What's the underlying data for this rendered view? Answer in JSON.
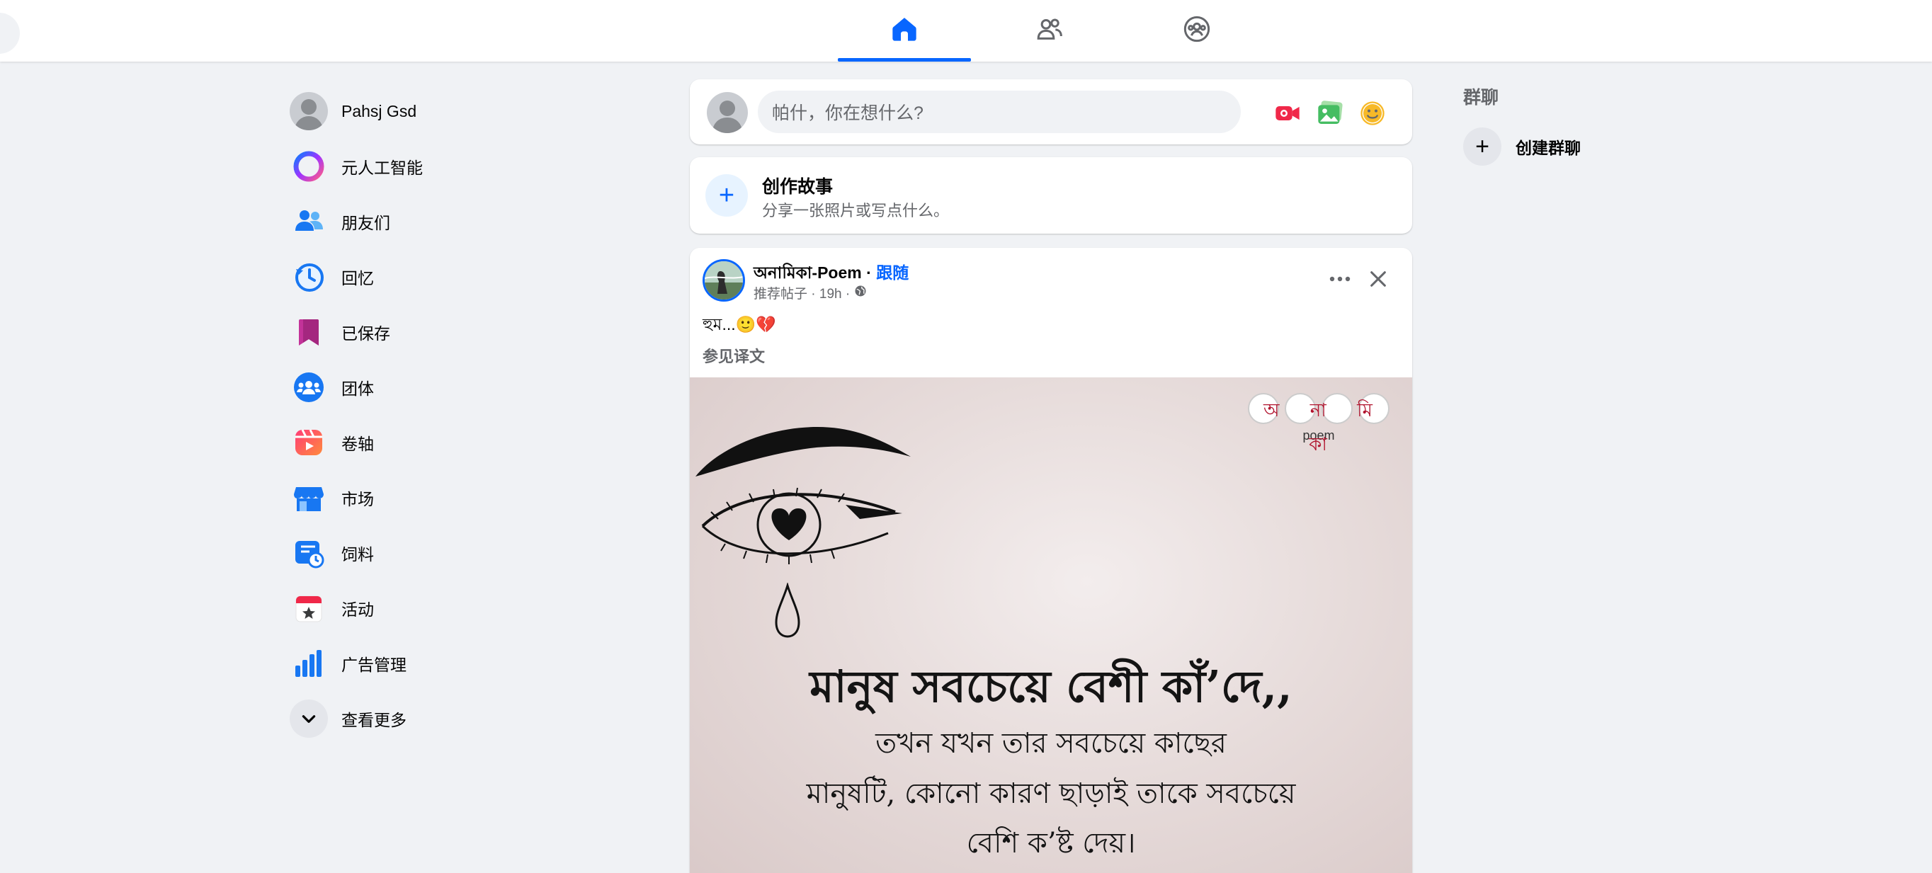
{
  "topbar": {
    "tabs": [
      {
        "name": "home",
        "icon": "home-icon",
        "active": true
      },
      {
        "name": "friends",
        "icon": "friends-icon",
        "active": false
      },
      {
        "name": "groups",
        "icon": "groups-icon",
        "active": false
      }
    ],
    "accent": "#0866ff"
  },
  "sidebar": {
    "items": [
      {
        "label": "Pahsj Gsd",
        "icon": "profile-avatar"
      },
      {
        "label": "元人工智能",
        "icon": "meta-ai-icon"
      },
      {
        "label": "朋友们",
        "icon": "friends-icon"
      },
      {
        "label": "回忆",
        "icon": "memories-icon"
      },
      {
        "label": "已保存",
        "icon": "saved-icon"
      },
      {
        "label": "团体",
        "icon": "groups-icon"
      },
      {
        "label": "卷轴",
        "icon": "reels-icon"
      },
      {
        "label": "市场",
        "icon": "marketplace-icon"
      },
      {
        "label": "饲料",
        "icon": "feeds-icon"
      },
      {
        "label": "活动",
        "icon": "events-icon"
      },
      {
        "label": "广告管理",
        "icon": "ads-manager-icon"
      },
      {
        "label": "查看更多",
        "icon": "chevron-down-icon"
      }
    ]
  },
  "composer": {
    "placeholder": "帕什，你在想什么?",
    "actions": [
      "live-video-icon",
      "photo-icon",
      "feeling-icon"
    ]
  },
  "story": {
    "title": "创作故事",
    "subtitle": "分享一张照片或写点什么。"
  },
  "post": {
    "author": "অনামিকা-Poem",
    "separator": " · ",
    "follow_label": "跟随",
    "meta": "推荐帖子 · 19h ·",
    "text": "হুম...🙂💔",
    "translate_label": "参见译文",
    "image_logo": "অ না মি কা",
    "image_logo_sub": "poem",
    "image_text": {
      "line1": "মানুষ সবচেয়ে বেশী কাঁ’দে,,",
      "line2": "তখন যখন তার সবচেয়ে কাছের",
      "line3": "মানুষটি, কোনো কারণ ছাড়াই তাকে সবচেয়ে",
      "line4": "বেশি ক’ষ্ট দেয়।"
    }
  },
  "rightcol": {
    "title": "群聊",
    "create_label": "创建群聊"
  }
}
